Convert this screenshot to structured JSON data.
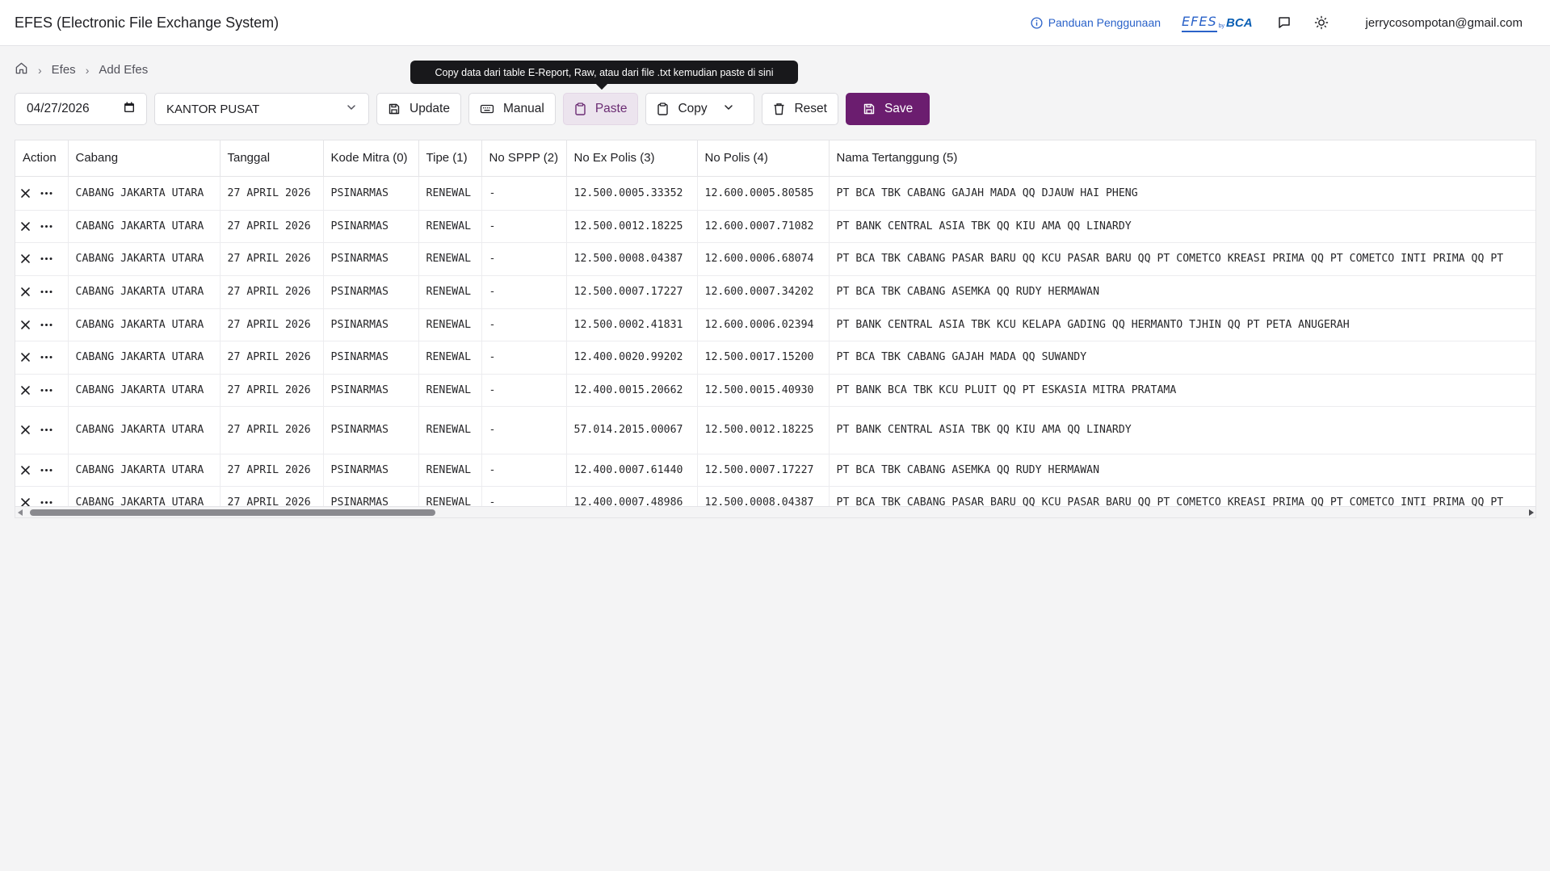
{
  "header": {
    "title": "EFES (Electronic File Exchange System)",
    "guide_label": "Panduan Penggunaan",
    "brand_efes": "EFES",
    "brand_by": "by",
    "brand_bca": "BCA",
    "user_email": "jerrycosompotan@gmail.com"
  },
  "breadcrumb": {
    "items": [
      "Efes",
      "Add Efes"
    ]
  },
  "tooltip": {
    "text": "Copy data dari table E-Report, Raw, atau dari file .txt kemudian paste di sini"
  },
  "toolbar": {
    "date_value": "04/27/2026",
    "office_value": "KANTOR PUSAT",
    "update_label": "Update",
    "manual_label": "Manual",
    "paste_label": "Paste",
    "copy_label": "Copy",
    "reset_label": "Reset",
    "save_label": "Save"
  },
  "colors": {
    "primary": "#6b1d6f",
    "link": "#2a62c9",
    "tooltip_bg": "#18181b"
  },
  "table": {
    "headers": [
      "Action",
      "Cabang",
      "Tanggal",
      "Kode Mitra (0)",
      "Tipe (1)",
      "No SPPP (2)",
      "No Ex Polis (3)",
      "No Polis (4)",
      "Nama Tertanggung (5)"
    ],
    "rows": [
      {
        "cabang": "CABANG JAKARTA UTARA",
        "tanggal": "27 APRIL 2026",
        "kode": "PSINARMAS",
        "tipe": "RENEWAL",
        "sppp": "-",
        "ex": "12.500.0005.33352",
        "polis": "12.600.0005.80585",
        "nama": "PT BCA TBK CABANG GAJAH MADA QQ DJAUW HAI PHENG"
      },
      {
        "cabang": "CABANG JAKARTA UTARA",
        "tanggal": "27 APRIL 2026",
        "kode": "PSINARMAS",
        "tipe": "RENEWAL",
        "sppp": "-",
        "ex": "12.500.0012.18225",
        "polis": "12.600.0007.71082",
        "nama": "PT BANK CENTRAL ASIA TBK QQ KIU AMA QQ LINARDY"
      },
      {
        "cabang": "CABANG JAKARTA UTARA",
        "tanggal": "27 APRIL 2026",
        "kode": "PSINARMAS",
        "tipe": "RENEWAL",
        "sppp": "-",
        "ex": "12.500.0008.04387",
        "polis": "12.600.0006.68074",
        "nama": "PT BCA TBK CABANG PASAR BARU QQ KCU PASAR BARU QQ PT COMETCO KREASI PRIMA QQ PT COMETCO INTI PRIMA QQ PT"
      },
      {
        "cabang": "CABANG JAKARTA UTARA",
        "tanggal": "27 APRIL 2026",
        "kode": "PSINARMAS",
        "tipe": "RENEWAL",
        "sppp": "-",
        "ex": "12.500.0007.17227",
        "polis": "12.600.0007.34202",
        "nama": "PT BCA TBK CABANG ASEMKA QQ RUDY HERMAWAN"
      },
      {
        "cabang": "CABANG JAKARTA UTARA",
        "tanggal": "27 APRIL 2026",
        "kode": "PSINARMAS",
        "tipe": "RENEWAL",
        "sppp": "-",
        "ex": "12.500.0002.41831",
        "polis": "12.600.0006.02394",
        "nama": "PT BANK CENTRAL ASIA TBK KCU KELAPA GADING QQ HERMANTO TJHIN QQ PT PETA ANUGERAH"
      },
      {
        "cabang": "CABANG JAKARTA UTARA",
        "tanggal": "27 APRIL 2026",
        "kode": "PSINARMAS",
        "tipe": "RENEWAL",
        "sppp": "-",
        "ex": "12.400.0020.99202",
        "polis": "12.500.0017.15200",
        "nama": "PT BCA TBK CABANG GAJAH MADA QQ SUWANDY"
      },
      {
        "cabang": "CABANG JAKARTA UTARA",
        "tanggal": "27 APRIL 2026",
        "kode": "PSINARMAS",
        "tipe": "RENEWAL",
        "sppp": "-",
        "ex": "12.400.0015.20662",
        "polis": "12.500.0015.40930",
        "nama": "PT BANK BCA TBK KCU PLUIT QQ PT ESKASIA MITRA PRATAMA"
      },
      {
        "cabang": "CABANG JAKARTA UTARA",
        "tanggal": "27 APRIL 2026",
        "kode": "PSINARMAS",
        "tipe": "RENEWAL",
        "sppp": "-",
        "ex": "57.014.2015.00067",
        "polis": "12.500.0012.18225",
        "nama": "PT BANK CENTRAL ASIA TBK QQ KIU AMA QQ LINARDY"
      },
      {
        "cabang": "CABANG JAKARTA UTARA",
        "tanggal": "27 APRIL 2026",
        "kode": "PSINARMAS",
        "tipe": "RENEWAL",
        "sppp": "-",
        "ex": "12.400.0007.61440",
        "polis": "12.500.0007.17227",
        "nama": "PT BCA TBK CABANG ASEMKA QQ RUDY HERMAWAN"
      },
      {
        "cabang": "CABANG JAKARTA UTARA",
        "tanggal": "27 APRIL 2026",
        "kode": "PSINARMAS",
        "tipe": "RENEWAL",
        "sppp": "-",
        "ex": "12.400.0007.48986",
        "polis": "12.500.0008.04387",
        "nama": "PT BCA TBK CABANG PASAR BARU QQ KCU PASAR BARU QQ PT COMETCO KREASI PRIMA QQ PT COMETCO INTI PRIMA QQ PT"
      }
    ]
  }
}
